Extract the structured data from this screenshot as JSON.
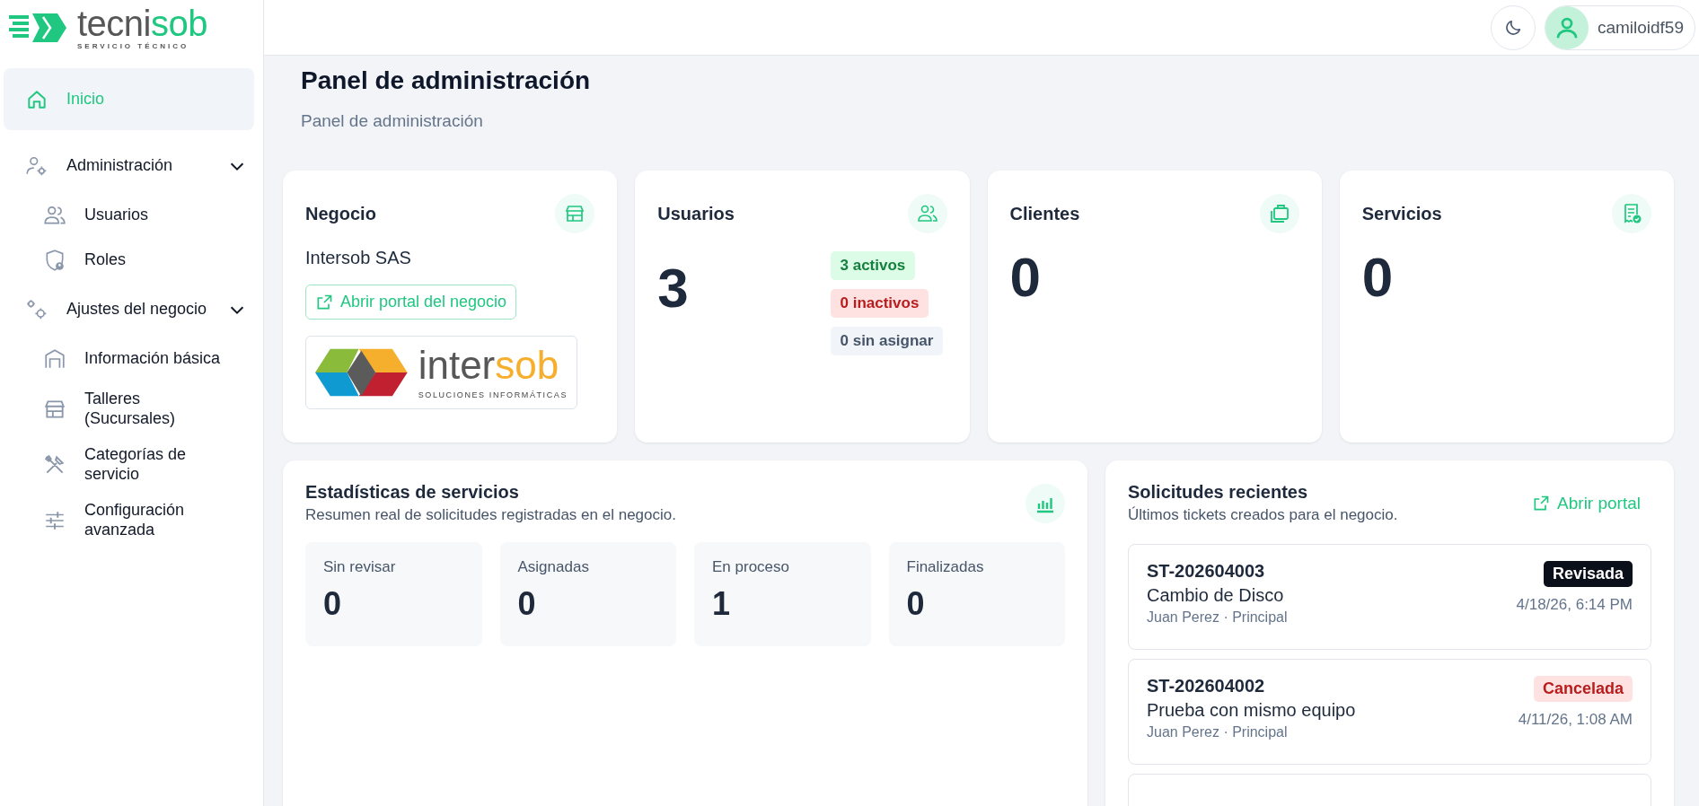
{
  "brand": {
    "name_start": "tecni",
    "name_end": "sob",
    "tagline": "SERVICIO TÉCNICO"
  },
  "sidebar": {
    "items": [
      {
        "label": "Inicio",
        "selected": true
      },
      {
        "label": "Administración",
        "selected": false,
        "expanded": true,
        "children": [
          {
            "label": "Usuarios",
            "selected": false
          },
          {
            "label": "Roles",
            "selected": false
          }
        ]
      },
      {
        "label": "Ajustes del negocio",
        "selected": false,
        "expanded": true,
        "children": [
          {
            "label": "Información básica",
            "selected": false
          },
          {
            "label": "Talleres (Sucursales)",
            "selected": false
          },
          {
            "label": "Categorías de servicio",
            "selected": false
          },
          {
            "label": "Configuración avanzada",
            "selected": false
          }
        ]
      }
    ]
  },
  "header": {
    "user": "camiloidf59"
  },
  "page": {
    "title": "Panel de administración",
    "subtitle": "Panel de administración"
  },
  "cards": [
    {
      "kind": "business",
      "title": "Negocio",
      "name": "Intersob SAS",
      "link": "Abrir portal del negocio",
      "logo": {
        "name_start": "inter",
        "name_end": "sob",
        "tagline": "SOLUCIONES INFORMÁTICAS"
      }
    },
    {
      "kind": "users",
      "title": "Usuarios",
      "value": "3",
      "badges": [
        {
          "label": "3 activos",
          "kind": "success"
        },
        {
          "label": "0 inactivos",
          "kind": "danger"
        },
        {
          "label": "0 sin asignar",
          "kind": "neutral"
        }
      ]
    },
    {
      "kind": "count",
      "title": "Clientes",
      "value": "0"
    },
    {
      "kind": "count",
      "title": "Servicios",
      "value": "0"
    }
  ],
  "stats": {
    "title": "Estadísticas de servicios",
    "subtitle": "Resumen real de solicitudes registradas en el negocio.",
    "tiles": [
      {
        "label": "Sin revisar",
        "value": "0"
      },
      {
        "label": "Asignadas",
        "value": "0"
      },
      {
        "label": "En proceso",
        "value": "1"
      },
      {
        "label": "Finalizadas",
        "value": "0"
      }
    ]
  },
  "recent": {
    "title": "Solicitudes recientes",
    "subtitle": "Últimos tickets creados para el negocio.",
    "link": "Abrir portal",
    "tickets": [
      {
        "code": "ST-202604003",
        "subject": "Cambio de Disco",
        "meta": "Juan Perez · Principal",
        "status": {
          "label": "Revisada",
          "kind": "dark"
        },
        "date": "4/18/26, 6:14 PM"
      },
      {
        "code": "ST-202604002",
        "subject": "Prueba con mismo equipo",
        "meta": "Juan Perez · Principal",
        "status": {
          "label": "Cancelada",
          "kind": "danger"
        },
        "date": "4/11/26, 1:08 AM"
      }
    ]
  }
}
